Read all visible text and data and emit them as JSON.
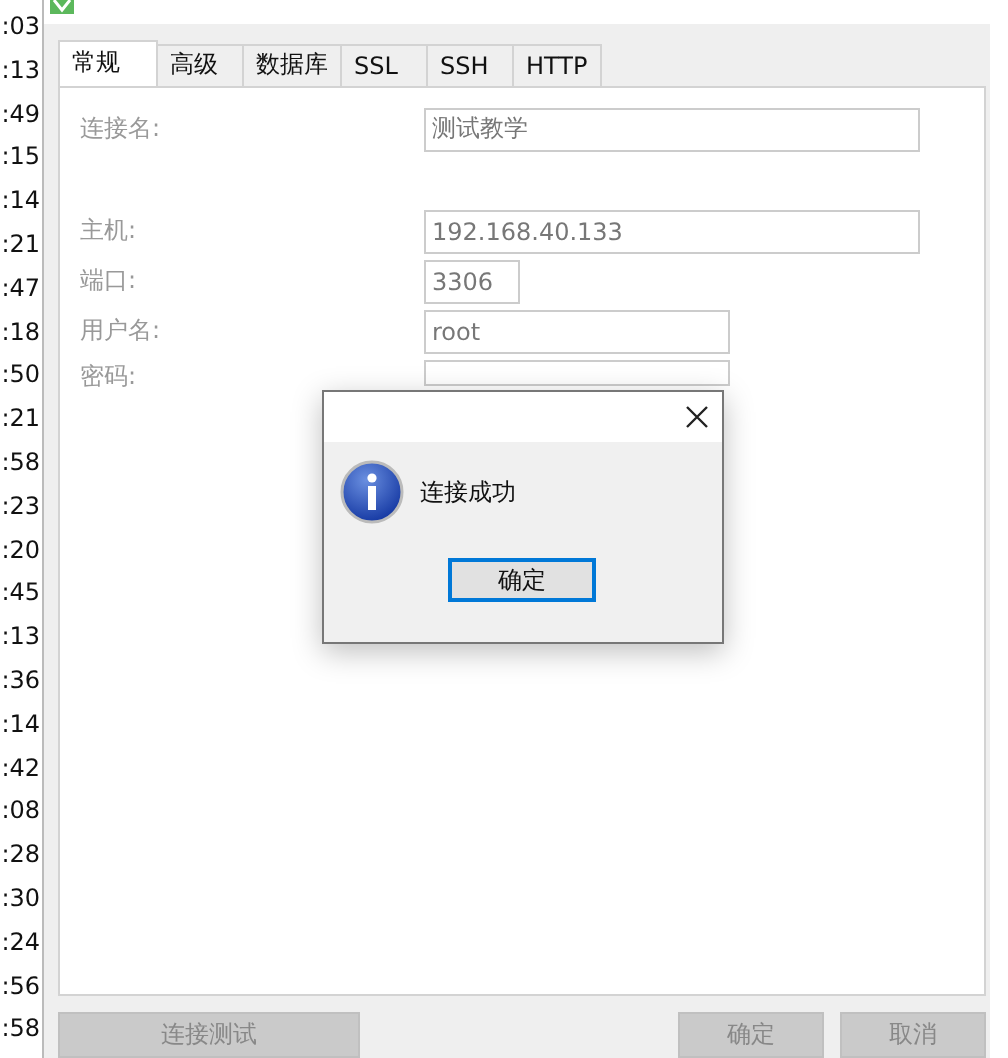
{
  "background_list": [
    ":03",
    ":13",
    ":49",
    ":15",
    ":14",
    ":21",
    ":47",
    ":18",
    ":50",
    ":21",
    ":58",
    ":23",
    ":20",
    ":45",
    ":13",
    ":36",
    ":14",
    ":42",
    ":08",
    ":28",
    ":30",
    ":24",
    ":56",
    ":58"
  ],
  "tabs": [
    {
      "label": "常规",
      "selected": true
    },
    {
      "label": "高级",
      "selected": false
    },
    {
      "label": "数据库",
      "selected": false
    },
    {
      "label": "SSL",
      "selected": false
    },
    {
      "label": "SSH",
      "selected": false
    },
    {
      "label": "HTTP",
      "selected": false
    }
  ],
  "fields": [
    {
      "label": "连接名:",
      "value": "测试教学"
    },
    {
      "label": "主机:",
      "value": "192.168.40.133"
    },
    {
      "label": "端口:",
      "value": "3306"
    },
    {
      "label": "用户名:",
      "value": "root"
    },
    {
      "label": "密码:"
    }
  ],
  "footer": {
    "test_button": "连接测试",
    "ok_button": "确定",
    "cancel_button": "取消"
  },
  "message_box": {
    "message": "连接成功",
    "button": "确定"
  }
}
